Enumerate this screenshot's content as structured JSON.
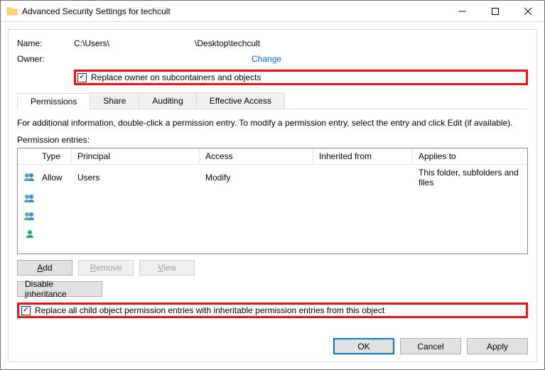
{
  "titlebar": {
    "title": "Advanced Security Settings for techcult"
  },
  "labels": {
    "name": "Name:",
    "owner": "Owner:",
    "change": "Change",
    "replace_owner": "Replace owner on subcontainers and objects"
  },
  "path": {
    "part1": "C:\\Users\\",
    "part2": "\\Desktop\\techcult"
  },
  "tabs": {
    "permissions": "Permissions",
    "share": "Share",
    "auditing": "Auditing",
    "effective": "Effective Access"
  },
  "info_text": "For additional information, double-click a permission entry. To modify a permission entry, select the entry and click Edit (if available).",
  "entries_label": "Permission entries:",
  "columns": {
    "type": "Type",
    "principal": "Principal",
    "access": "Access",
    "inherited": "Inherited from",
    "applies": "Applies to"
  },
  "rows": [
    {
      "type": "Allow",
      "principal": "Users",
      "access": "Modify",
      "inherited": "",
      "applies": "This folder, subfolders and files"
    },
    {
      "type": "",
      "principal": "",
      "access": "",
      "inherited": "",
      "applies": ""
    },
    {
      "type": "",
      "principal": "",
      "access": "",
      "inherited": "",
      "applies": ""
    },
    {
      "type": "",
      "principal": "",
      "access": "",
      "inherited": "",
      "applies": ""
    }
  ],
  "buttons": {
    "add": "Add",
    "remove": "Remove",
    "view": "View",
    "disable_inherit": "Disable inheritance"
  },
  "replace_all": "Replace all child object permission entries with inheritable permission entries from this object",
  "dlg": {
    "ok": "OK",
    "cancel": "Cancel",
    "apply": "Apply"
  }
}
